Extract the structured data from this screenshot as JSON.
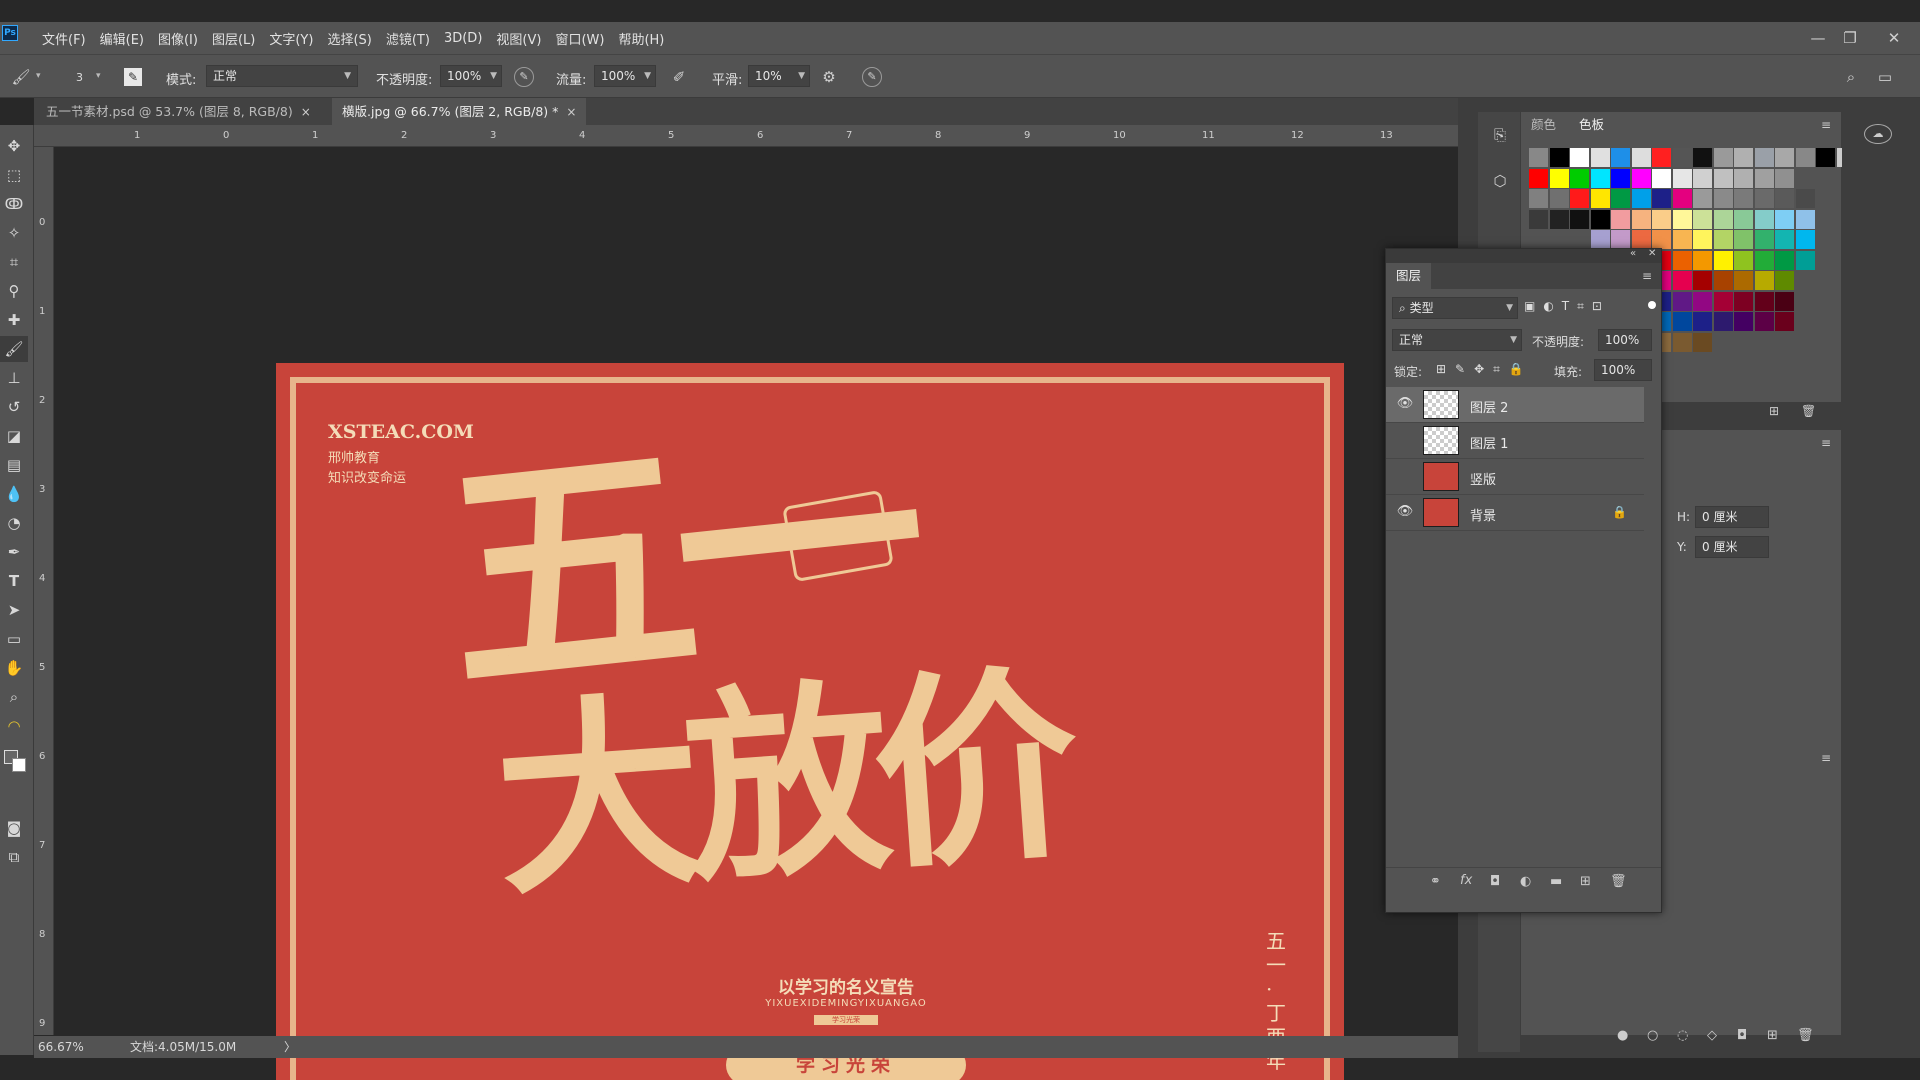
{
  "app": {
    "logo": "Ps"
  },
  "menu": [
    "文件(F)",
    "编辑(E)",
    "图像(I)",
    "图层(L)",
    "文字(Y)",
    "选择(S)",
    "滤镜(T)",
    "3D(D)",
    "视图(V)",
    "窗口(W)",
    "帮助(H)"
  ],
  "window_controls": {
    "minimize": "—",
    "restore": "❐",
    "close": "✕"
  },
  "options": {
    "brush_size": "3",
    "mode_label": "模式:",
    "mode_value": "正常",
    "opacity_label": "不透明度:",
    "opacity_value": "100%",
    "flow_label": "流量:",
    "flow_value": "100%",
    "smooth_label": "平滑:",
    "smooth_value": "10%"
  },
  "tabs": [
    {
      "label": "五一节素材.psd @ 53.7% (图层 8, RGB/8)",
      "close": "×"
    },
    {
      "label": "横版.jpg @ 66.7% (图层 2, RGB/8) *",
      "close": "×"
    }
  ],
  "ruler": {
    "top": [
      "1",
      "0",
      "1",
      "2",
      "3",
      "4",
      "5",
      "6",
      "7",
      "8",
      "9",
      "10",
      "11",
      "12",
      "13"
    ],
    "left": [
      "0",
      "1",
      "2",
      "3",
      "4",
      "5",
      "6",
      "7",
      "8",
      "9"
    ]
  },
  "poster": {
    "site": "XSTEAC.COM",
    "line1": "邢帅教育",
    "line2": "知识改变命运",
    "big_top": "五一",
    "big_bottom": "大放价",
    "slogan_cn": "以学习的名义宣告",
    "slogan_en": "YIXUEXIDEMINGYIXUANGAO",
    "stamp_small": "学习光荣",
    "banner": "学习光荣",
    "vertical": "五一·丁酉年"
  },
  "status": {
    "zoom": "66.67%",
    "doc": "文档:4.05M/15.0M",
    "arrow": "〉"
  },
  "swatch_panel": {
    "tabs": [
      "颜色",
      "色板"
    ],
    "active": 1
  },
  "swatch_colors": {
    "row0": [
      "#888888",
      "#000000",
      "#ffffff",
      "#e0e0e0",
      "#1e8fe8",
      "#dddddd",
      "#ff2020",
      "#555555",
      "#111111",
      "#9a9a9a",
      "#b0b0b0",
      "#9aa0a8",
      "#a8a8a8",
      "#888888",
      "#000000",
      "#cccccc"
    ],
    "row1": [
      "#ff0000",
      "#ffff00",
      "#00cc00",
      "#00e5ff",
      "#0000ff",
      "#ff00ff",
      "#ffffff",
      "#e6e6e6",
      "#d0d0d0",
      "#c0c0c0",
      "#b0b0b0",
      "#a0a0a0",
      "#909090"
    ],
    "row2": [
      "#808080",
      "#707070",
      "#ff1a1a",
      "#ffe600",
      "#009944",
      "#00a0e9",
      "#1d2088",
      "#e4007f",
      "#9a9a9a",
      "#8a8a8a",
      "#7a7a7a",
      "#6a6a6a",
      "#5a5a5a",
      "#4a4a4a"
    ],
    "row3": [
      "#3a3a3a",
      "#222222",
      "#111111",
      "#000000",
      "#f29c9f",
      "#f6b37f",
      "#facd89",
      "#fff799",
      "#cce198",
      "#acd598",
      "#89c997",
      "#84ccc9",
      "#7ecef4",
      "#8fc1e9"
    ],
    "row4": [
      "#a6a0d0",
      "#c39ac9",
      "#ec6941",
      "#f19149",
      "#f8b551",
      "#fff45c",
      "#b3d465",
      "#80c269",
      "#32b16c",
      "#13b5b1",
      "#00b7ee"
    ],
    "row5": [
      "#e60012",
      "#eb6100",
      "#f39800",
      "#fff100",
      "#8fc31f",
      "#22ac38",
      "#009944",
      "#009e96"
    ],
    "row6": [
      "#e4007f",
      "#e5004f",
      "#a40000",
      "#a84200",
      "#ac6a00",
      "#b7aa00",
      "#5f8a00"
    ],
    "row7": [
      "#1d2088",
      "#601986",
      "#920783",
      "#a40035",
      "#7d0022",
      "#63001a",
      "#4a0014"
    ],
    "row8": [
      "#0068b7",
      "#00479d",
      "#1d2088",
      "#2d1a6e",
      "#440062",
      "#5c0046",
      "#6a001c"
    ],
    "row9": [
      "#8b6a3e",
      "#7a5a30",
      "#6a4a22"
    ]
  },
  "layers": {
    "title": "图层",
    "filter": "类型",
    "blend": "正常",
    "opacity_label": "不透明度:",
    "opacity": "100%",
    "lock_label": "锁定:",
    "fill_label": "填充:",
    "fill": "100%",
    "items": [
      {
        "name": "图层 2",
        "visible": true,
        "selected": true
      },
      {
        "name": "图层 1",
        "visible": false,
        "selected": false
      },
      {
        "name": "竖版",
        "visible": false,
        "selected": false
      },
      {
        "name": "背景",
        "visible": true,
        "selected": false,
        "locked": true
      }
    ]
  },
  "properties": {
    "h_label": "H:",
    "h_value": "0 厘米",
    "y_label": "Y:",
    "y_value": "0 厘米"
  }
}
